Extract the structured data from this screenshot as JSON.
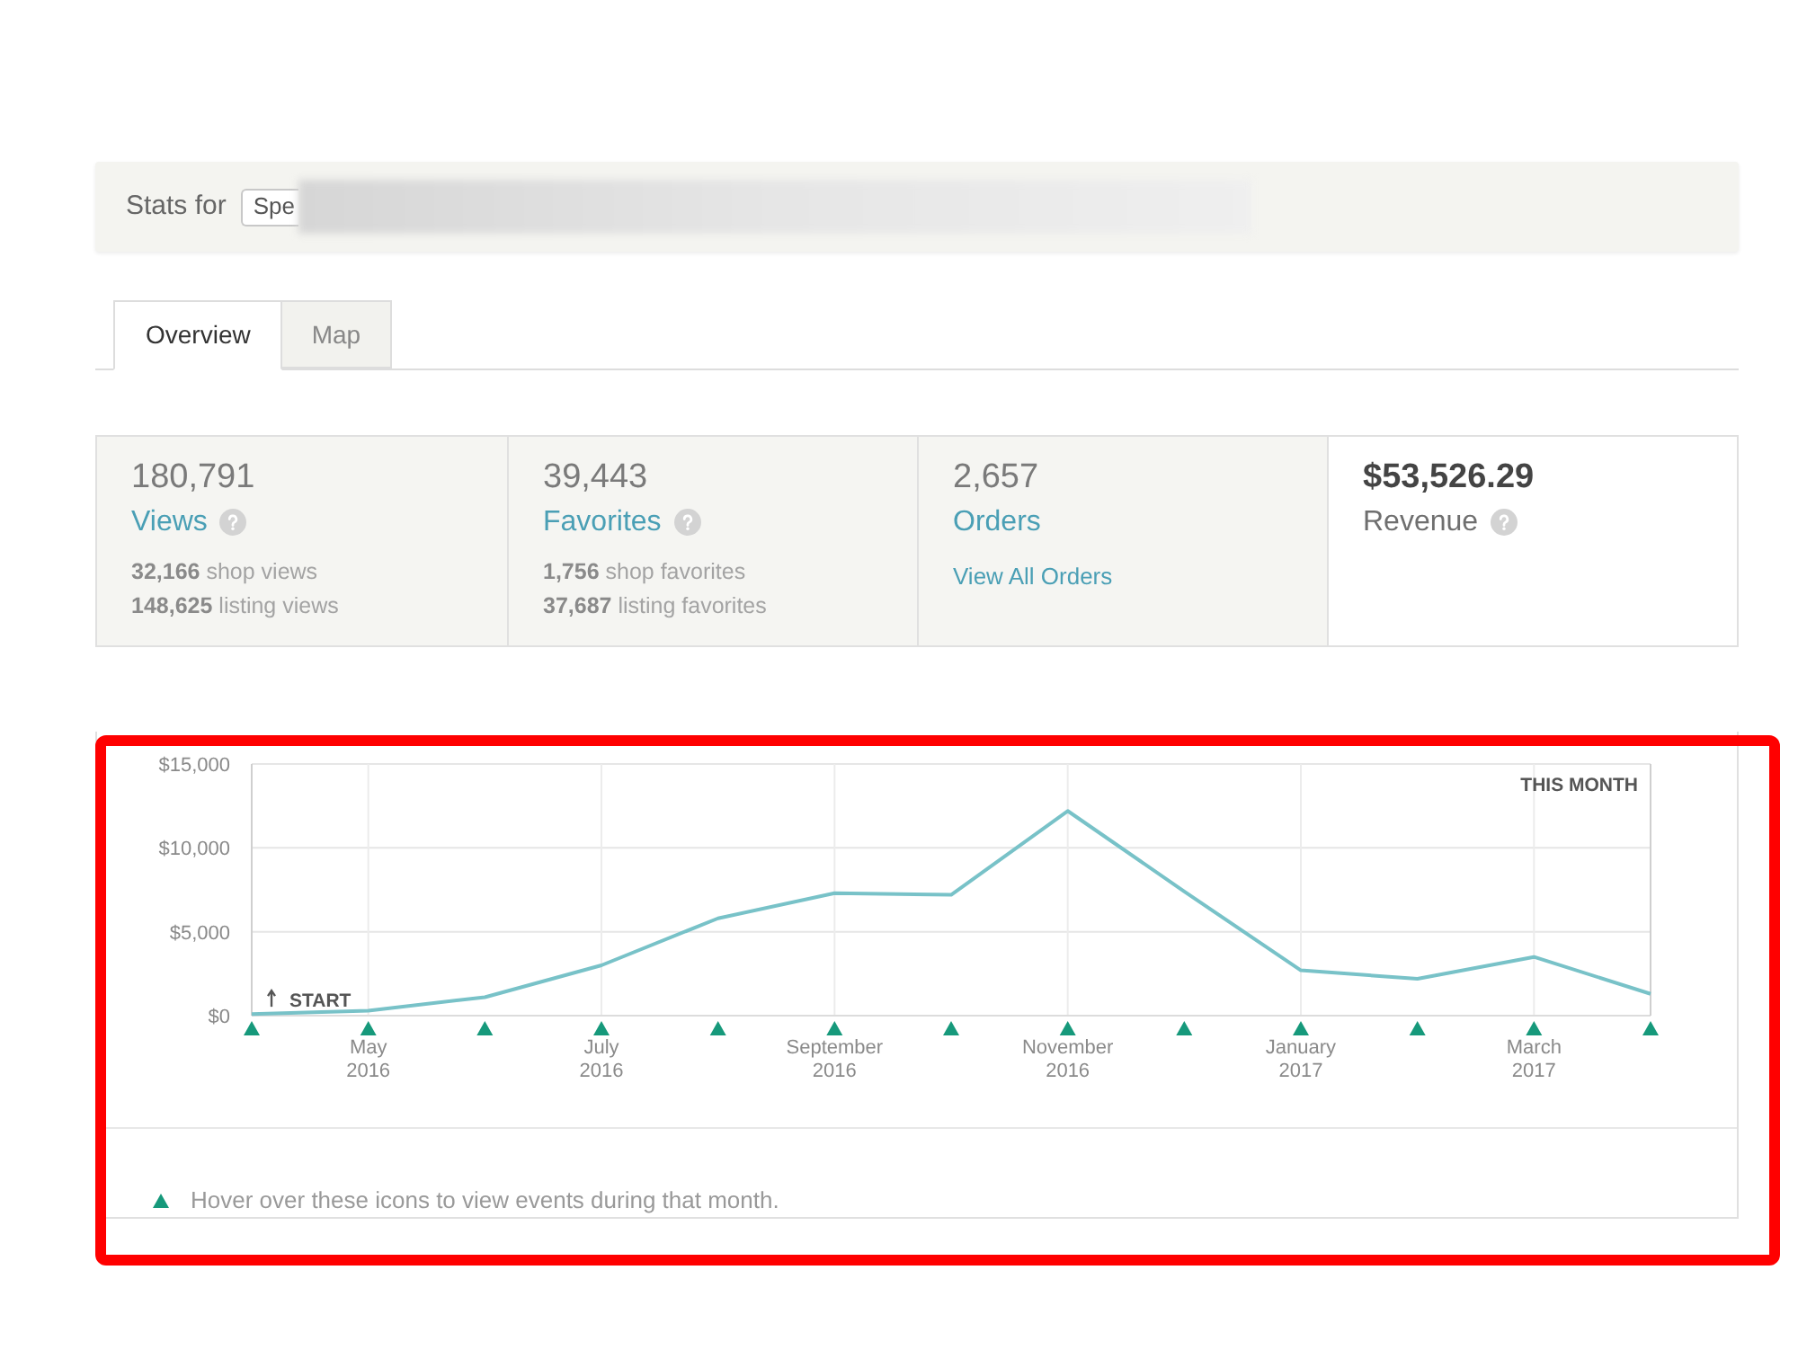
{
  "stats_bar": {
    "label": "Stats for",
    "shop_select": {
      "value": "Spe"
    }
  },
  "tabs": [
    {
      "label": "Overview",
      "selected": true
    },
    {
      "label": "Map",
      "selected": false
    }
  ],
  "stat_cards": [
    {
      "value": "180,791",
      "label": "Views",
      "help": true,
      "selected": false,
      "details": [
        "**32,166** shop views",
        "**148,625** listing views"
      ]
    },
    {
      "value": "39,443",
      "label": "Favorites",
      "help": true,
      "selected": false,
      "details": [
        "**1,756** shop favorites",
        "**37,687** listing favorites"
      ]
    },
    {
      "value": "2,657",
      "label": "Orders",
      "help": false,
      "selected": false,
      "link": "View All Orders"
    },
    {
      "value": "$53,526.29",
      "label": "Revenue",
      "help": true,
      "selected": true
    }
  ],
  "chart": {
    "chart_data": {
      "type": "line",
      "categories": [
        null,
        "May 2016",
        null,
        "July 2016",
        null,
        "September 2016",
        null,
        "November 2016",
        null,
        "January 2017",
        null,
        "March 2017",
        null
      ],
      "series": [
        {
          "color": "#78c2c8",
          "values": [
            100,
            300,
            1100,
            3000,
            5800,
            7300,
            7200,
            12200,
            7400,
            2700,
            2200,
            3500,
            1300
          ]
        }
      ],
      "ylim": [
        0,
        15000
      ],
      "yticks": [
        {
          "value": 0,
          "label": "$0"
        },
        {
          "value": 5000,
          "label": "$5,000"
        },
        {
          "value": 10000,
          "label": "$10,000"
        },
        {
          "value": 15000,
          "label": "$15,000"
        }
      ],
      "grid": true,
      "annotations": [
        {
          "text": "START",
          "y": 100
        },
        "THIS MONTH"
      ]
    }
  },
  "footer": {
    "note": "Hover over these icons to view events during that month."
  }
}
